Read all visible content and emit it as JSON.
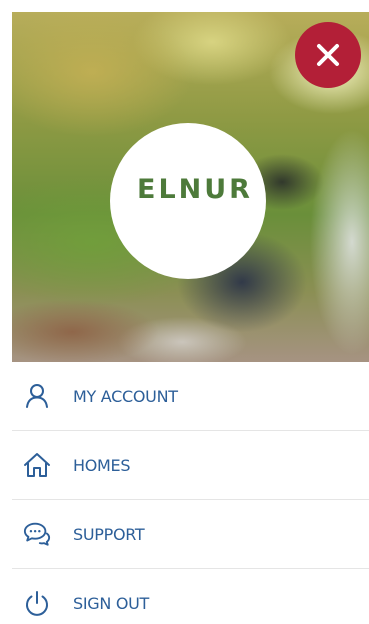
{
  "brand": {
    "logo_text": "ELNUR",
    "logo_color": "#4d7a3a"
  },
  "header": {
    "close_icon": "close-icon",
    "close_button_color": "#b31f37"
  },
  "menu": {
    "text_color": "#2d5f99",
    "items": [
      {
        "label": "MY ACCOUNT",
        "icon": "user-icon"
      },
      {
        "label": "HOMES",
        "icon": "home-icon"
      },
      {
        "label": "SUPPORT",
        "icon": "chat-bubbles-icon"
      },
      {
        "label": "SIGN OUT",
        "icon": "power-icon"
      }
    ]
  }
}
